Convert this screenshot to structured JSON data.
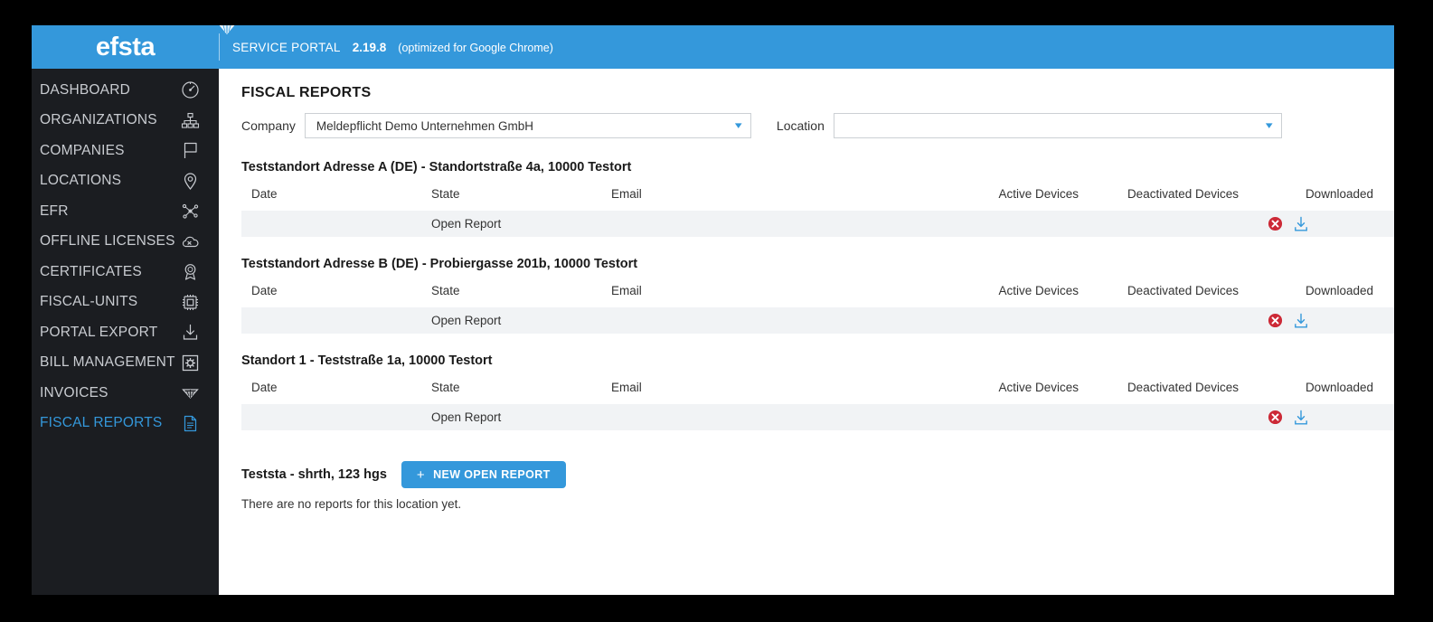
{
  "header": {
    "brand": "efsta",
    "brand_mark_icon": "efsta-logo-mark",
    "portal_label": "SERVICE PORTAL",
    "version": "2.19.8",
    "note": "(optimized for Google Chrome)",
    "accent_color": "#3498db"
  },
  "sidebar": {
    "background_color": "#1b1d21",
    "active_color": "#3498db",
    "items": [
      {
        "label": "DASHBOARD",
        "icon": "gauge-icon",
        "active": false
      },
      {
        "label": "ORGANIZATIONS",
        "icon": "org-chart-icon",
        "active": false
      },
      {
        "label": "COMPANIES",
        "icon": "flag-icon",
        "active": false
      },
      {
        "label": "LOCATIONS",
        "icon": "map-pin-icon",
        "active": false
      },
      {
        "label": "EFR",
        "icon": "network-nodes-icon",
        "active": false
      },
      {
        "label": "OFFLINE LICENSES",
        "icon": "cloud-off-icon",
        "active": false
      },
      {
        "label": "CERTIFICATES",
        "icon": "award-rosette-icon",
        "active": false
      },
      {
        "label": "FISCAL-UNITS",
        "icon": "chip-icon",
        "active": false
      },
      {
        "label": "PORTAL EXPORT",
        "icon": "download-tray-icon",
        "active": false
      },
      {
        "label": "BILL MANAGEMENT",
        "icon": "gear-box-icon",
        "active": false
      },
      {
        "label": "INVOICES",
        "icon": "efsta-mark-icon",
        "active": false
      },
      {
        "label": "FISCAL REPORTS",
        "icon": "document-icon",
        "active": true
      }
    ]
  },
  "main": {
    "page_title": "FISCAL REPORTS",
    "filters": {
      "company_label": "Company",
      "company_value": "Meldepflicht Demo Unternehmen GmbH",
      "company_placeholder": "",
      "location_label": "Location",
      "location_value": "",
      "location_placeholder": "",
      "chevron_icon": "chevron-down-icon"
    },
    "columns": [
      "Date",
      "State",
      "Email",
      "Active Devices",
      "Deactivated Devices",
      "Downloaded"
    ],
    "sections": [
      {
        "title": "Teststandort Adresse A (DE) - Standortstraße 4a, 10000 Testort",
        "rows": [
          {
            "date": "",
            "state": "Open Report",
            "email": "",
            "active_devices": "",
            "deactivated_devices": "",
            "downloaded_status_icon": "red-x-circle-icon",
            "download_action_icon": "download-icon"
          }
        ]
      },
      {
        "title": "Teststandort Adresse B (DE) - Probiergasse 201b, 10000 Testort",
        "rows": [
          {
            "date": "",
            "state": "Open Report",
            "email": "",
            "active_devices": "",
            "deactivated_devices": "",
            "downloaded_status_icon": "red-x-circle-icon",
            "download_action_icon": "download-icon"
          }
        ]
      },
      {
        "title": "Standort 1 - Teststraße 1a, 10000 Testort",
        "rows": [
          {
            "date": "",
            "state": "Open Report",
            "email": "",
            "active_devices": "",
            "deactivated_devices": "",
            "downloaded_status_icon": "red-x-circle-icon",
            "download_action_icon": "download-icon"
          }
        ]
      }
    ],
    "last_section": {
      "title": "Teststa - shrth, 123 hgs",
      "new_report_button": "NEW OPEN REPORT",
      "new_report_plus_icon": "plus-icon",
      "empty_message": "There are no reports for this location yet."
    }
  }
}
